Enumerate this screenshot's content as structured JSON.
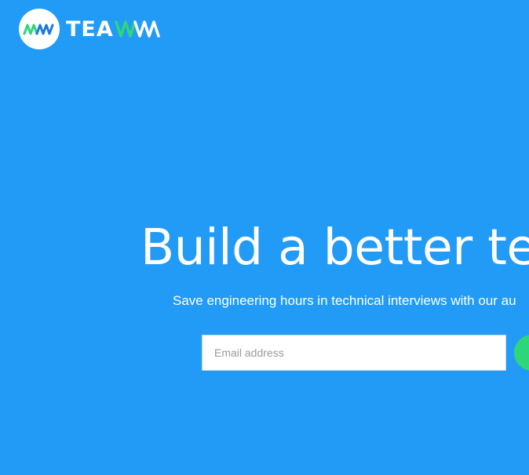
{
  "brand": {
    "wordmark": "TEA",
    "logo_icon": "wave-icon",
    "wave_colors": [
      "#2ed67a",
      "#1a78e0"
    ]
  },
  "hero": {
    "title": "Build a better te",
    "subtitle": "Save engineering hours in technical interviews with our au"
  },
  "signup": {
    "email_placeholder": "Email address",
    "button_label": ""
  },
  "colors": {
    "background": "#229bf6",
    "cta": "#2ed67a",
    "text": "#ffffff"
  }
}
